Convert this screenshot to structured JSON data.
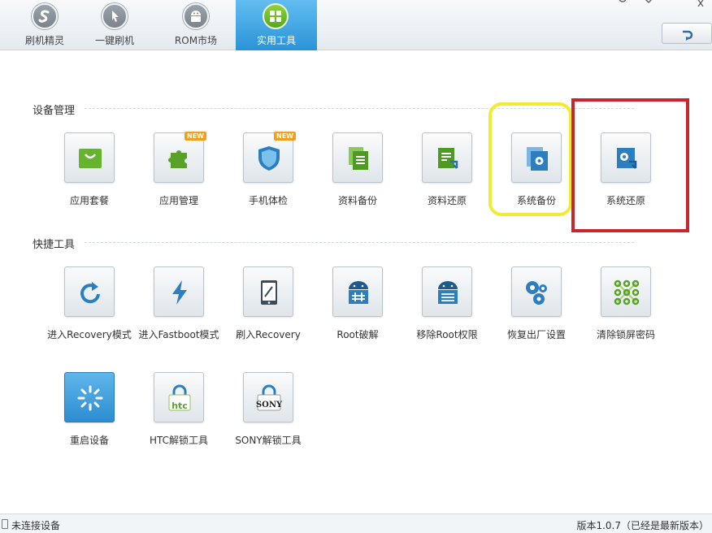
{
  "nav": {
    "tabs": [
      {
        "label": "刷机精灵",
        "icon": "shuaji-logo-icon"
      },
      {
        "label": "一键刷机",
        "icon": "one-click-icon"
      },
      {
        "label": "ROM市场",
        "icon": "android-icon"
      },
      {
        "label": "实用工具",
        "icon": "grid-icon",
        "active": true
      }
    ],
    "window_buttons": [
      "minimize",
      "menu",
      "close"
    ],
    "close_glyph": "x"
  },
  "sections": [
    {
      "title": "设备管理",
      "tools": [
        {
          "label": "应用套餐",
          "icon": "shopping-bag-icon"
        },
        {
          "label": "应用管理",
          "icon": "puzzle-icon",
          "badge": "NEW"
        },
        {
          "label": "手机体检",
          "icon": "shield-icon",
          "badge": "NEW"
        },
        {
          "label": "资料备份",
          "icon": "document-stack-icon"
        },
        {
          "label": "资料还原",
          "icon": "document-restore-icon"
        },
        {
          "label": "系统备份",
          "icon": "gear-backup-icon"
        },
        {
          "label": "系统还原",
          "icon": "gear-restore-icon"
        }
      ]
    },
    {
      "title": "快捷工具",
      "tools": [
        {
          "label": "进入Recovery模式",
          "icon": "refresh-icon"
        },
        {
          "label": "进入Fastboot模式",
          "icon": "lightning-icon"
        },
        {
          "label": "刷入Recovery",
          "icon": "tablet-edit-icon"
        },
        {
          "label": "Root破解",
          "icon": "android-root-icon"
        },
        {
          "label": "移除Root权限",
          "icon": "android-unroot-icon"
        },
        {
          "label": "恢复出厂设置",
          "icon": "gears-icon"
        },
        {
          "label": "清除锁屏密码",
          "icon": "pattern-lock-icon"
        },
        {
          "label": "重启设备",
          "icon": "spinner-icon"
        },
        {
          "label": "HTC解锁工具",
          "icon": "htc-lock-icon",
          "logo_text": "htc"
        },
        {
          "label": "SONY解锁工具",
          "icon": "sony-lock-icon",
          "logo_text": "SONY"
        }
      ]
    }
  ],
  "status": {
    "device": "未连接设备",
    "version": "版本1.0.7（已经是最新版本）"
  },
  "colors": {
    "active_tab": "#2a93d8",
    "icon_green": "#5aa12a",
    "icon_blue": "#2b7fc0",
    "highlight_yellow": "#f2ea33",
    "highlight_red": "#c4282e"
  }
}
